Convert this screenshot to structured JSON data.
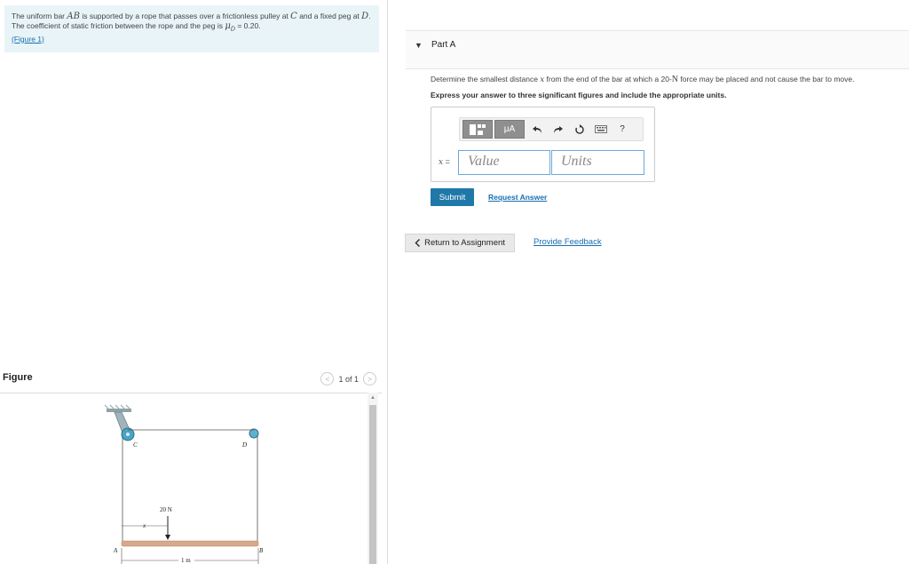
{
  "problem": {
    "text_1": "The uniform bar",
    "var_ab": "AB",
    "text_2": "is supported by a rope that passes over a frictionless pulley at",
    "var_c": "C",
    "text_3": "and a fixed peg at",
    "var_d": "D",
    "text_4": ". The coefficient of static friction between the rope and the peg is",
    "var_mu": "μ",
    "var_mu_sub": "D",
    "text_5": "= 0.20.",
    "figure_link": "(Figure 1)"
  },
  "figure": {
    "title": "Figure",
    "pager_text": "1 of 1",
    "prev_glyph": "<",
    "next_glyph": ">",
    "labels": {
      "a": "A",
      "b": "B",
      "c": "C",
      "d": "D",
      "force": "20 N",
      "x": "x",
      "length": "1 m"
    }
  },
  "part": {
    "caret": "▼",
    "title": "Part A",
    "question_1": "Determine the smallest distance",
    "question_var": "x",
    "question_2": "from the end of the bar at which a 20-",
    "question_unit": "N",
    "question_3": "force may be placed and not cause the bar to move.",
    "instruction": "Express your answer to three significant figures and include the appropriate units.",
    "toolbar": {
      "units_btn": "μA",
      "help": "?"
    },
    "var_label": "x",
    "var_eq": "=",
    "value_placeholder": "Value",
    "units_placeholder": "Units",
    "submit": "Submit",
    "request_answer": "Request Answer"
  },
  "footer": {
    "return_label": "Return to Assignment",
    "feedback_label": "Provide Feedback"
  }
}
